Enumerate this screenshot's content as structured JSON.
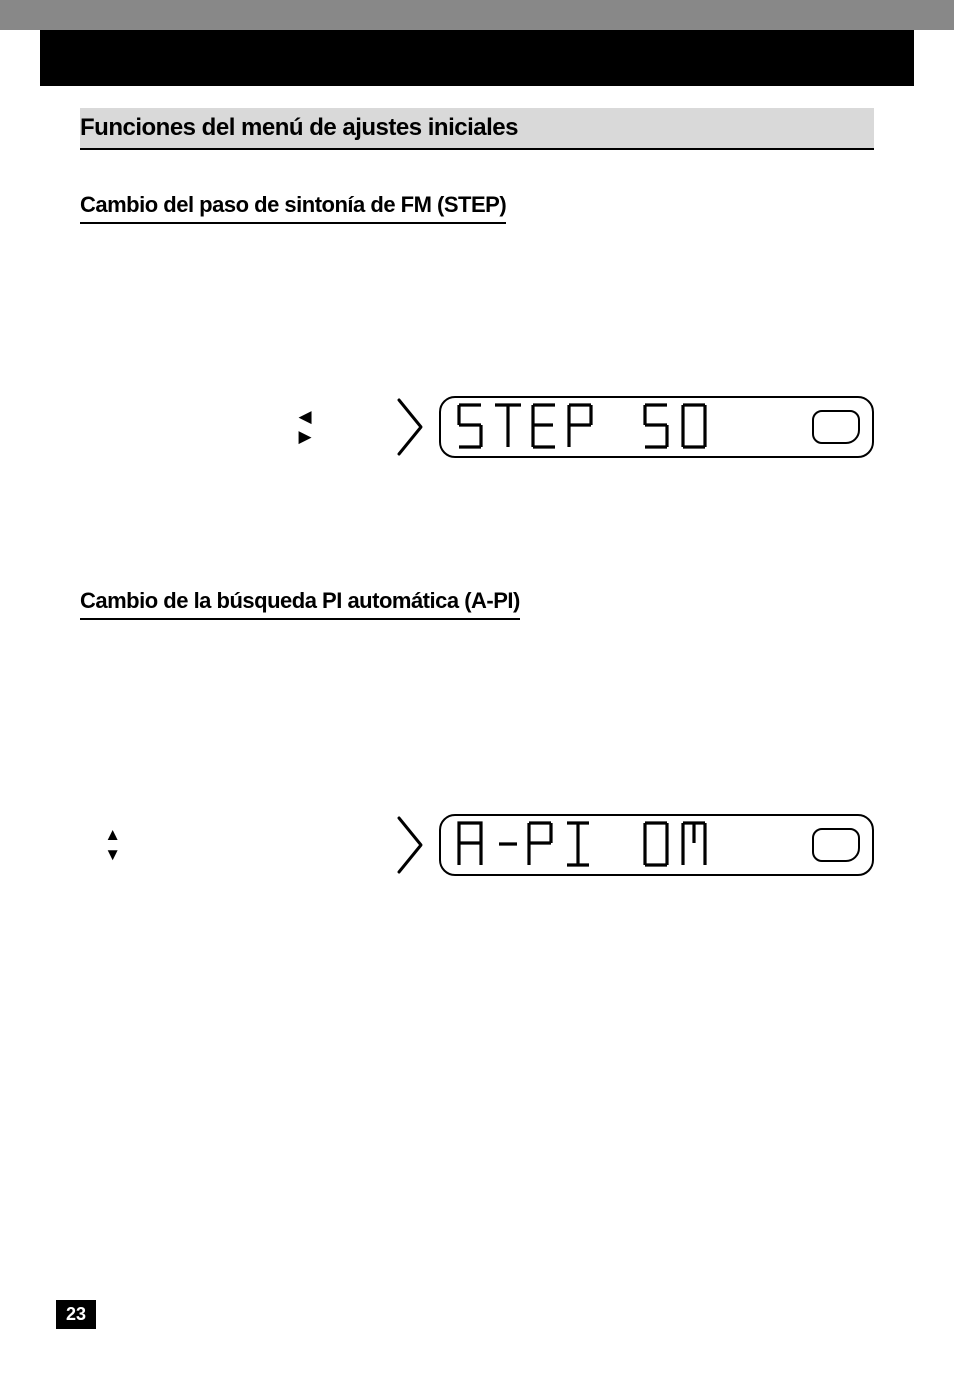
{
  "page_number": "23",
  "main_title": "Funciones del menú de ajustes iniciales",
  "section1": {
    "title": "Cambio del paso de sintonía de FM (STEP)",
    "arrow_glyphs_lr": "◀ ▶",
    "lcd_text_word1": "STEP",
    "lcd_text_word2": "50"
  },
  "section2": {
    "title": "Cambio de la búsqueda PI automática (A-PI)",
    "arrow_glyphs_ud": "▲ ▼",
    "lcd_text_word1": "A-PI",
    "lcd_text_word2": "ON"
  }
}
